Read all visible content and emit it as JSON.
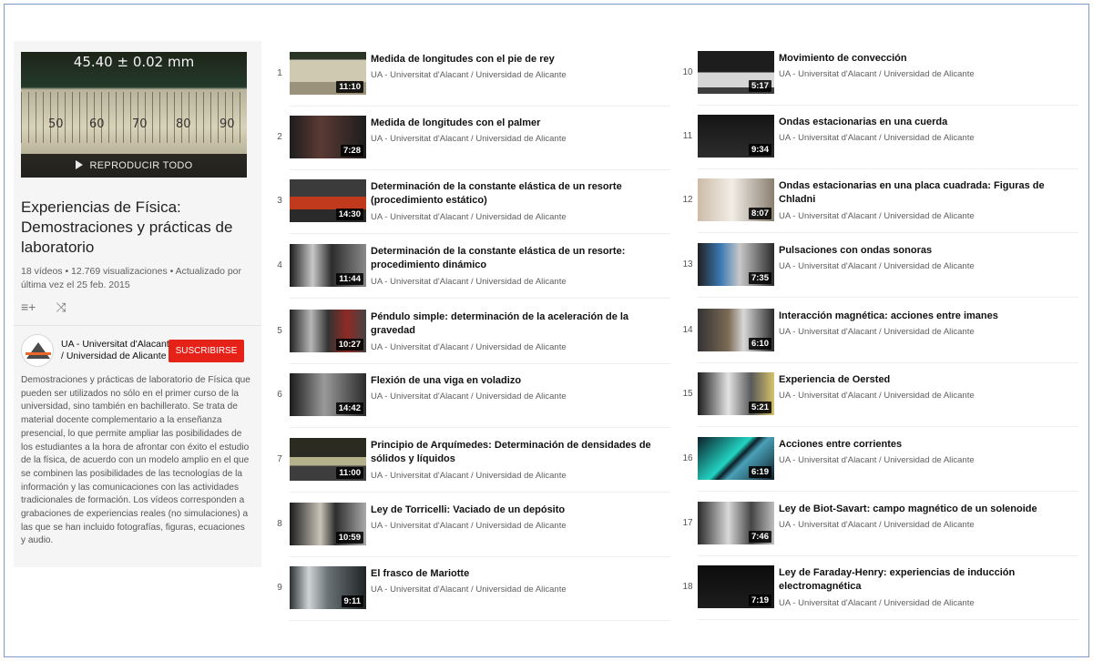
{
  "playlist": {
    "thumb_overlay": "45.40 ± 0.02 mm",
    "ruler_numbers": [
      "50",
      "60",
      "70",
      "80",
      "90"
    ],
    "play_all_label": "REPRODUCIR TODO",
    "title": "Experiencias de Física: Demostraciones y prácticas de laboratorio",
    "stats": "18 vídeos • 12.769 visualizaciones • Actualizado por última vez el 25 feb. 2015",
    "add_icon": "≡+",
    "shuffle_icon": "⤨",
    "channel_name": "UA - Universitat d'Alacant / Universidad de Alicante",
    "subscribe_label": "SUSCRIBIRSE",
    "description": "Demostraciones y prácticas de laboratorio de Física que pueden ser utilizados  no sólo en el primer curso de la universidad, sino también en bachillerato. Se trata de material docente complementario a la enseñanza presencial, lo que permite ampliar las posibilidades de los estudiantes a la hora de afrontar con éxito el estudio de la física, de acuerdo con un modelo amplio en el que se combinen las posibilidades de las tecnologías de la información y las comunicaciones con las actividades tradicionales de formación. Los vídeos corresponden a grabaciones de experiencias reales (no simulaciones) a las que se han incluido fotografías, figuras, ecuaciones y audio."
  },
  "videos": [
    {
      "num": "1",
      "title": "Medida de longitudes con el pie de rey",
      "duration": "11:10",
      "channel": "UA - Universitat d'Alacant / Universidad de Alicante"
    },
    {
      "num": "2",
      "title": "Medida de longitudes con el palmer",
      "duration": "7:28",
      "channel": "UA - Universitat d'Alacant / Universidad de Alicante"
    },
    {
      "num": "3",
      "title": "Determinación de la constante elástica de un resorte (procedimiento estático)",
      "duration": "14:30",
      "channel": "UA - Universitat d'Alacant / Universidad de Alicante"
    },
    {
      "num": "4",
      "title": "Determinación de la constante elástica de un resorte: procedimiento dinámico",
      "duration": "11:44",
      "channel": "UA - Universitat d'Alacant / Universidad de Alicante"
    },
    {
      "num": "5",
      "title": "Péndulo simple: determinación de la aceleración de la gravedad",
      "duration": "10:27",
      "channel": "UA - Universitat d'Alacant / Universidad de Alicante"
    },
    {
      "num": "6",
      "title": "Flexión de una viga en voladizo",
      "duration": "14:42",
      "channel": "UA - Universitat d'Alacant / Universidad de Alicante"
    },
    {
      "num": "7",
      "title": "Principio de Arquímedes: Determinación de densidades de sólidos y líquidos",
      "duration": "11:00",
      "channel": "UA - Universitat d'Alacant / Universidad de Alicante"
    },
    {
      "num": "8",
      "title": "Ley de Torricelli: Vaciado de un depósito",
      "duration": "10:59",
      "channel": "UA - Universitat d'Alacant / Universidad de Alicante"
    },
    {
      "num": "9",
      "title": "El frasco de Mariotte",
      "duration": "9:11",
      "channel": "UA - Universitat d'Alacant / Universidad de Alicante"
    },
    {
      "num": "10",
      "title": "Movimiento de convección",
      "duration": "5:17",
      "channel": "UA - Universitat d'Alacant / Universidad de Alicante"
    },
    {
      "num": "11",
      "title": "Ondas estacionarias en una cuerda",
      "duration": "9:34",
      "channel": "UA - Universitat d'Alacant / Universidad de Alicante"
    },
    {
      "num": "12",
      "title": "Ondas estacionarias en una placa cuadrada: Figuras de Chladni",
      "duration": "8:07",
      "channel": "UA - Universitat d'Alacant / Universidad de Alicante"
    },
    {
      "num": "13",
      "title": "Pulsaciones con ondas sonoras",
      "duration": "7:35",
      "channel": "UA - Universitat d'Alacant / Universidad de Alicante"
    },
    {
      "num": "14",
      "title": "Interacción magnética: acciones entre imanes",
      "duration": "6:10",
      "channel": "UA - Universitat d'Alacant / Universidad de Alicante"
    },
    {
      "num": "15",
      "title": "Experiencia de Oersted",
      "duration": "5:21",
      "channel": "UA - Universitat d'Alacant / Universidad de Alicante"
    },
    {
      "num": "16",
      "title": "Acciones entre corrientes",
      "duration": "6:19",
      "channel": "UA - Universitat d'Alacant / Universidad de Alicante"
    },
    {
      "num": "17",
      "title": "Ley de Biot-Savart: campo magnético de un solenoide",
      "duration": "7:46",
      "channel": "UA - Universitat d'Alacant / Universidad de Alicante"
    },
    {
      "num": "18",
      "title": "Ley de Faraday-Henry: experiencias de inducción electromagnética",
      "duration": "7:19",
      "channel": "UA - Universitat d'Alacant / Universidad de Alicante"
    }
  ]
}
